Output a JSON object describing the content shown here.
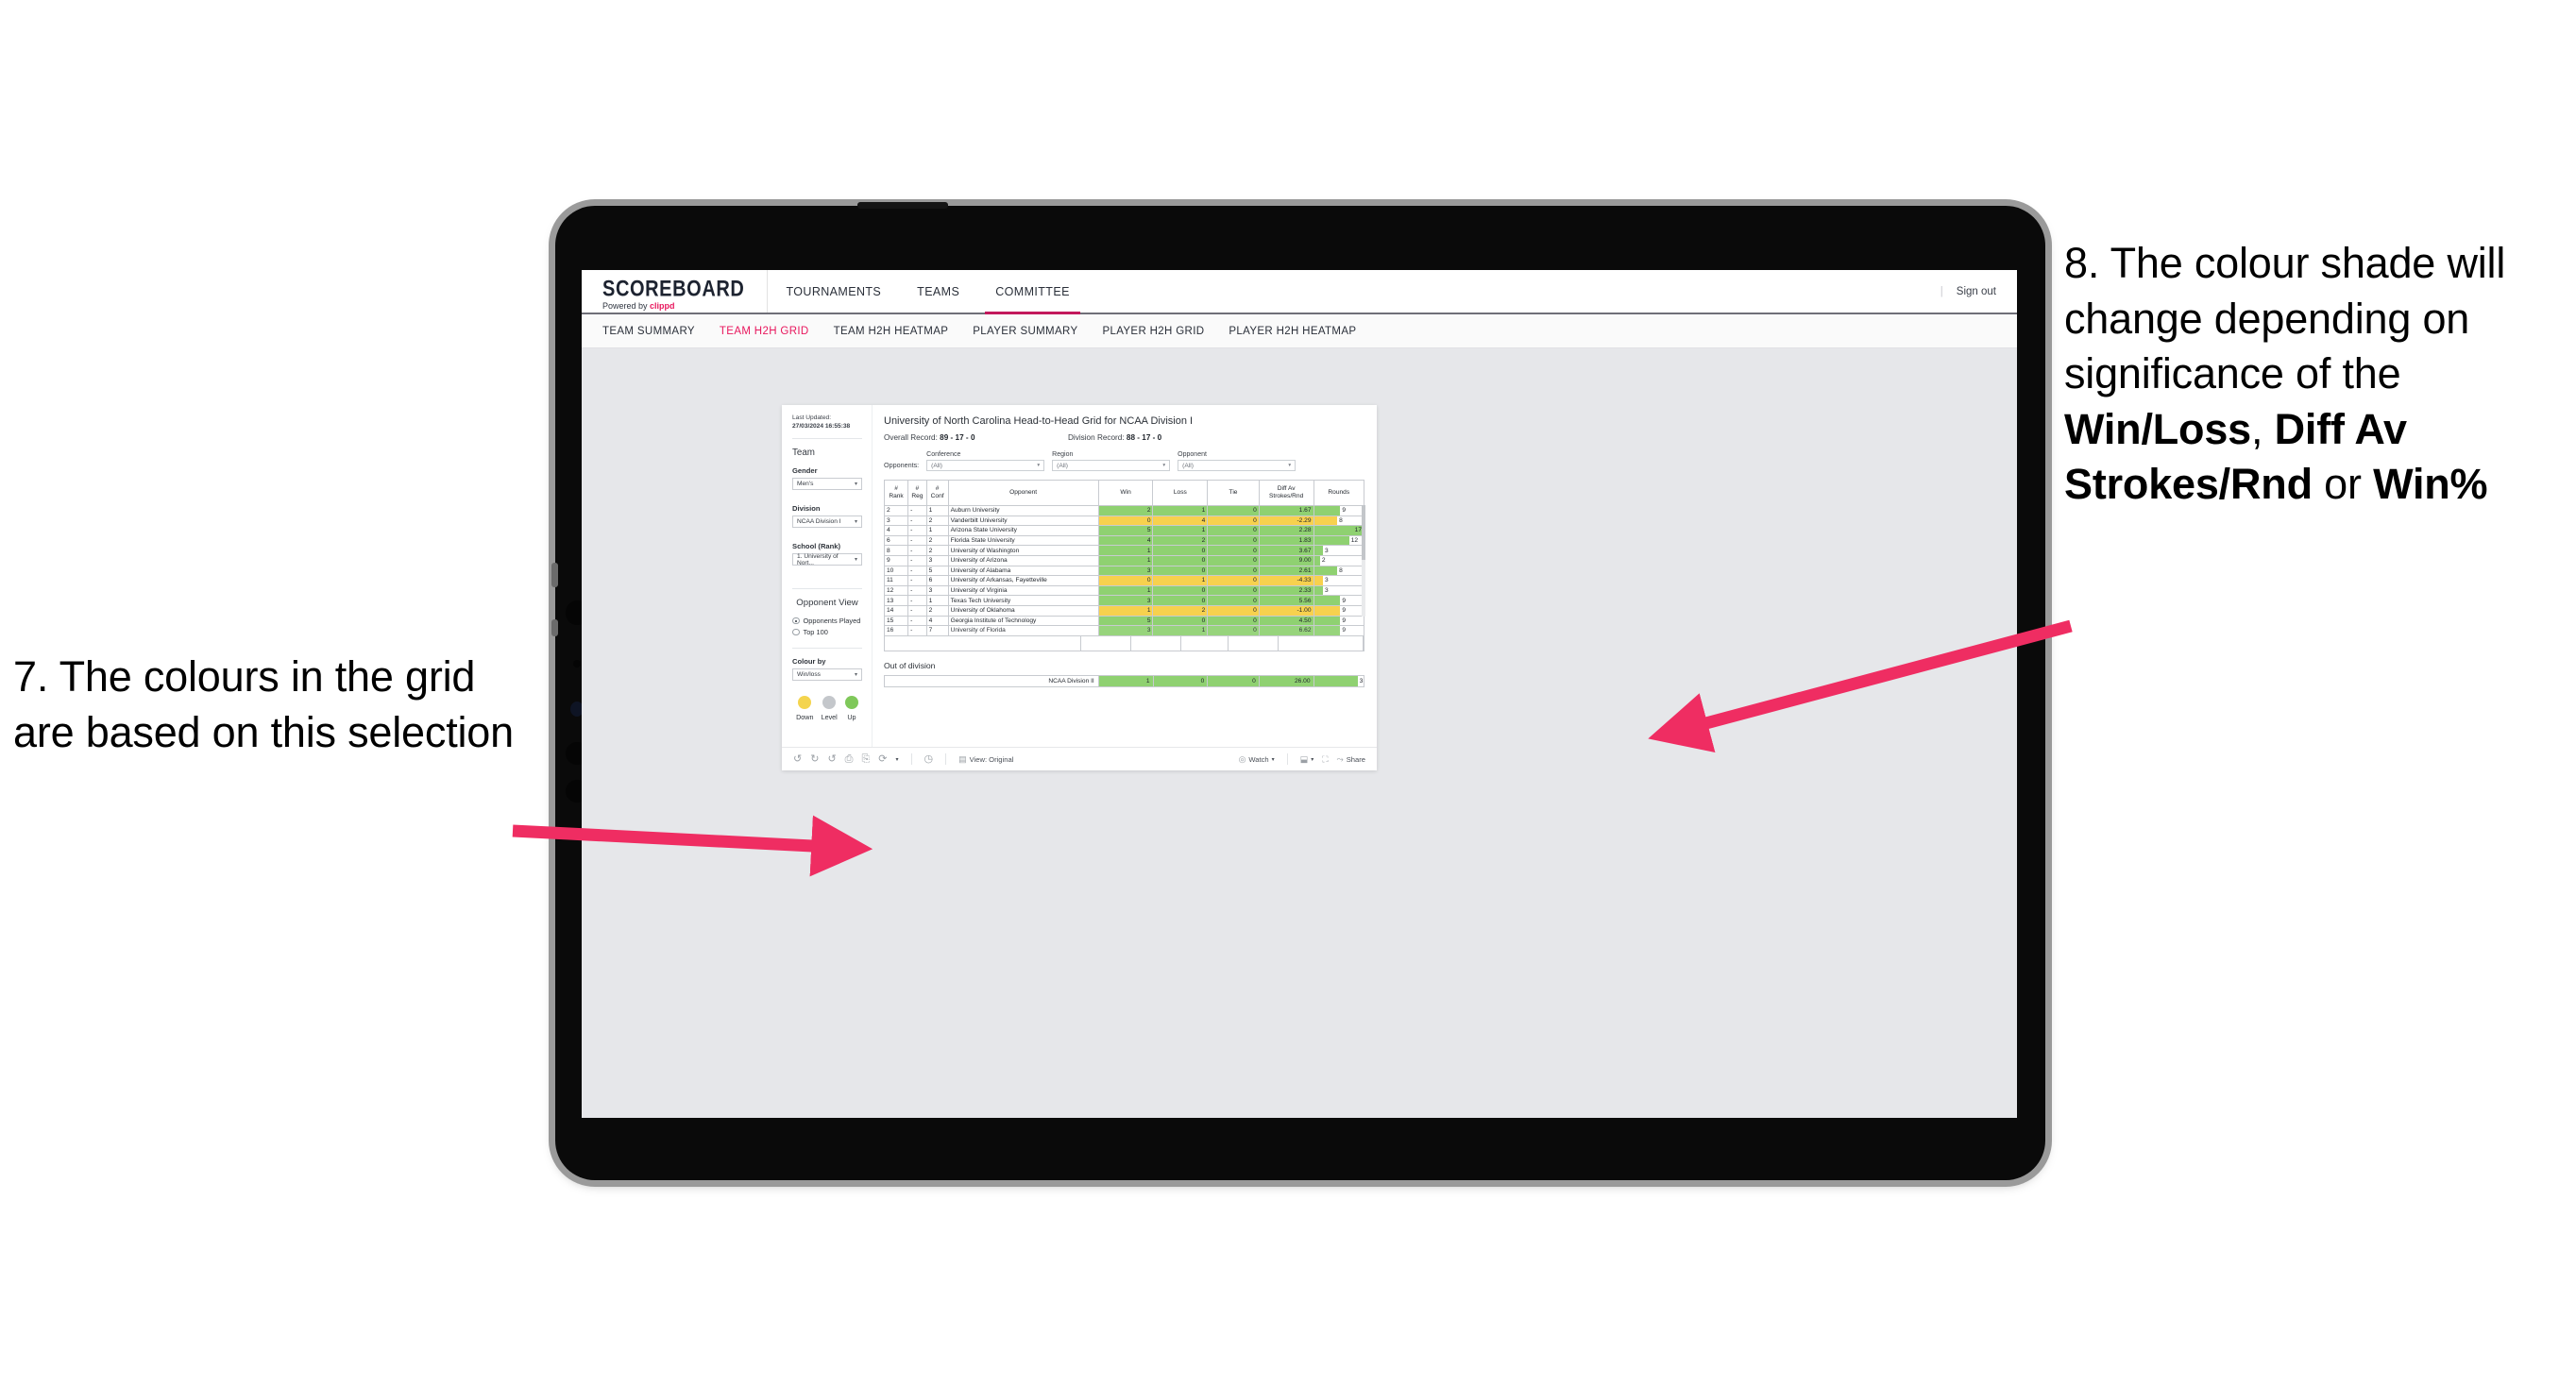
{
  "annotations": {
    "left": {
      "number": "7.",
      "text": "7. The colours in the grid are based on this selection"
    },
    "right": {
      "parts": [
        {
          "t": "8. The colour shade will change depending on significance of the ",
          "b": false
        },
        {
          "t": "Win/Loss",
          "b": true
        },
        {
          "t": ", ",
          "b": false
        },
        {
          "t": "Diff Av Strokes/Rnd",
          "b": true
        },
        {
          "t": " or ",
          "b": false
        },
        {
          "t": "Win%",
          "b": true
        }
      ]
    },
    "arrow_color": "#ef2d62"
  },
  "app": {
    "brand_title": "SCOREBOARD",
    "brand_sub_pre": "Powered by ",
    "brand_sub_name": "clippd",
    "brand_accent": "#e8175d",
    "top_nav": [
      {
        "label": "TOURNAMENTS",
        "active": false
      },
      {
        "label": "TEAMS",
        "active": false
      },
      {
        "label": "COMMITTEE",
        "active": true
      }
    ],
    "sign_out": "Sign out",
    "sub_nav": [
      {
        "label": "TEAM SUMMARY",
        "active": false
      },
      {
        "label": "TEAM H2H GRID",
        "active": true
      },
      {
        "label": "TEAM H2H HEATMAP",
        "active": false
      },
      {
        "label": "PLAYER SUMMARY",
        "active": false
      },
      {
        "label": "PLAYER H2H GRID",
        "active": false
      },
      {
        "label": "PLAYER H2H HEATMAP",
        "active": false
      }
    ]
  },
  "sidebar": {
    "last_updated_label": "Last Updated:",
    "last_updated_value": "27/03/2024 16:55:38",
    "team_heading": "Team",
    "gender_label": "Gender",
    "gender_value": "Men's",
    "division_label": "Division",
    "division_value": "NCAA Division I",
    "school_label": "School (Rank)",
    "school_value": "1. University of Nort...",
    "opponent_view_heading": "Opponent View",
    "opponent_view_options": [
      {
        "label": "Opponents Played",
        "selected": true
      },
      {
        "label": "Top 100",
        "selected": false
      }
    ],
    "colour_by_label": "Colour by",
    "colour_by_value": "Win/loss",
    "legend": [
      {
        "label": "Down",
        "color": "#f4d44e"
      },
      {
        "label": "Level",
        "color": "#c4c7cb"
      },
      {
        "label": "Up",
        "color": "#7fc85a"
      }
    ]
  },
  "main": {
    "title": "University of North Carolina Head-to-Head Grid for NCAA Division I",
    "overall_record_label": "Overall Record:",
    "overall_record_value": "89 - 17 - 0",
    "division_record_label": "Division Record:",
    "division_record_value": "88 - 17 - 0",
    "opponents_label": "Opponents:",
    "filters": [
      {
        "label": "Conference",
        "value": "(All)"
      },
      {
        "label": "Region",
        "value": "(All)"
      },
      {
        "label": "Opponent",
        "value": "(All)"
      }
    ],
    "columns": [
      "# Rank",
      "# Reg",
      "# Conf",
      "Opponent",
      "Win",
      "Loss",
      "Tie",
      "Diff Av Strokes/Rnd",
      "Rounds"
    ],
    "column_lines": [
      [
        "#",
        "Rank"
      ],
      [
        "#",
        "Reg"
      ],
      [
        "#",
        "Conf"
      ],
      [
        "Opponent"
      ],
      [
        "Win"
      ],
      [
        "Loss"
      ],
      [
        "Tie"
      ],
      [
        "Diff Av",
        "Strokes/Rnd"
      ],
      [
        "Rounds"
      ]
    ],
    "rows": [
      {
        "rank": "2",
        "reg": "-",
        "conf": "1",
        "opponent": "Auburn University",
        "win": "2",
        "loss": "1",
        "tie": "0",
        "diff": "1.67",
        "rounds": "9",
        "rounds_pct": 53,
        "shade": "g"
      },
      {
        "rank": "3",
        "reg": "-",
        "conf": "2",
        "opponent": "Vanderbilt University",
        "win": "0",
        "loss": "4",
        "tie": "0",
        "diff": "-2.29",
        "rounds": "8",
        "rounds_pct": 47,
        "shade": "y"
      },
      {
        "rank": "4",
        "reg": "-",
        "conf": "1",
        "opponent": "Arizona State University",
        "win": "5",
        "loss": "1",
        "tie": "0",
        "diff": "2.28",
        "rounds": "17",
        "rounds_pct": 100,
        "shade": "g"
      },
      {
        "rank": "6",
        "reg": "-",
        "conf": "2",
        "opponent": "Florida State University",
        "win": "4",
        "loss": "2",
        "tie": "0",
        "diff": "1.83",
        "rounds": "12",
        "rounds_pct": 71,
        "shade": "g"
      },
      {
        "rank": "8",
        "reg": "-",
        "conf": "2",
        "opponent": "University of Washington",
        "win": "1",
        "loss": "0",
        "tie": "0",
        "diff": "3.67",
        "rounds": "3",
        "rounds_pct": 18,
        "shade": "g"
      },
      {
        "rank": "9",
        "reg": "-",
        "conf": "3",
        "opponent": "University of Arizona",
        "win": "1",
        "loss": "0",
        "tie": "0",
        "diff": "9.00",
        "rounds": "2",
        "rounds_pct": 12,
        "shade": "g"
      },
      {
        "rank": "10",
        "reg": "-",
        "conf": "5",
        "opponent": "University of Alabama",
        "win": "3",
        "loss": "0",
        "tie": "0",
        "diff": "2.61",
        "rounds": "8",
        "rounds_pct": 47,
        "shade": "g"
      },
      {
        "rank": "11",
        "reg": "-",
        "conf": "6",
        "opponent": "University of Arkansas, Fayetteville",
        "win": "0",
        "loss": "1",
        "tie": "0",
        "diff": "-4.33",
        "rounds": "3",
        "rounds_pct": 18,
        "shade": "y"
      },
      {
        "rank": "12",
        "reg": "-",
        "conf": "3",
        "opponent": "University of Virginia",
        "win": "1",
        "loss": "0",
        "tie": "0",
        "diff": "2.33",
        "rounds": "3",
        "rounds_pct": 18,
        "shade": "g"
      },
      {
        "rank": "13",
        "reg": "-",
        "conf": "1",
        "opponent": "Texas Tech University",
        "win": "3",
        "loss": "0",
        "tie": "0",
        "diff": "5.56",
        "rounds": "9",
        "rounds_pct": 53,
        "shade": "g"
      },
      {
        "rank": "14",
        "reg": "-",
        "conf": "2",
        "opponent": "University of Oklahoma",
        "win": "1",
        "loss": "2",
        "tie": "0",
        "diff": "-1.00",
        "rounds": "9",
        "rounds_pct": 53,
        "shade": "y"
      },
      {
        "rank": "15",
        "reg": "-",
        "conf": "4",
        "opponent": "Georgia Institute of Technology",
        "win": "5",
        "loss": "0",
        "tie": "0",
        "diff": "4.50",
        "rounds": "9",
        "rounds_pct": 53,
        "shade": "g"
      },
      {
        "rank": "16",
        "reg": "-",
        "conf": "7",
        "opponent": "University of Florida",
        "win": "3",
        "loss": "1",
        "tie": "0",
        "diff": "6.62",
        "rounds": "9",
        "rounds_pct": 53,
        "shade": "g"
      }
    ],
    "out_of_division_title": "Out of division",
    "out_of_division_row": {
      "label": "NCAA Division II",
      "win": "1",
      "loss": "0",
      "tie": "0",
      "diff": "26.00",
      "rounds": "3",
      "rounds_pct": 88,
      "shade": "g"
    }
  },
  "viz_toolbar": {
    "undo_icon": "undo-icon",
    "redo_icon": "redo-icon",
    "revert_icon": "revert-icon",
    "refresh_icon": "refresh-icon",
    "pause_icon": "pause-icon",
    "share_link_icon": "share-link-icon",
    "alerts_icon": "alerts-icon",
    "view_label": "View: Original",
    "watch_label": "Watch",
    "download_label": "download-icon",
    "fullscreen_label": "fullscreen-icon",
    "share_label": "Share"
  },
  "colors": {
    "green": "#8fd171",
    "yellow": "#f7d14e",
    "accent_pink": "#e8175d",
    "arrow": "#ef2d62",
    "screen_bg": "#e6e7ea"
  }
}
